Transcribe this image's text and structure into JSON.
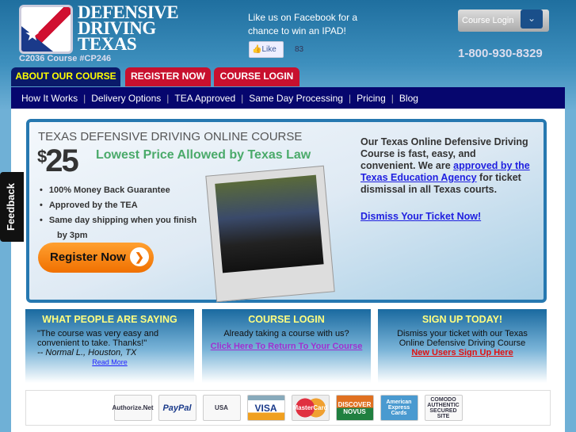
{
  "header": {
    "logo_lines": [
      "DEFENSIVE",
      "DRIVING",
      "TEXAS"
    ],
    "course_number": "C2036 Course #CP246",
    "facebook_text": "Like us on Facebook for a chance to win an IPAD!",
    "like_label": "Like",
    "like_count": "83",
    "course_login": "Course Login",
    "phone": "1-800-930-8329"
  },
  "tabs": [
    "ABOUT OUR COURSE",
    "REGISTER NOW",
    "COURSE LOGIN"
  ],
  "nav": [
    "How It Works",
    "Delivery Options",
    "TEA Approved",
    "Same Day Processing",
    "Pricing",
    "Blog"
  ],
  "hero": {
    "title": "TEXAS DEFENSIVE DRIVING ONLINE COURSE",
    "currency": "$",
    "price": "25",
    "tagline": "Lowest Price Allowed by Texas Law",
    "bullets": [
      "100% Money Back Guarantee",
      "Approved by the TEA",
      "Same day shipping when you finish"
    ],
    "bullet_cont": "by 3pm",
    "register": "Register Now",
    "desc_pre": "Our Texas Online Defensive Driving Course is fast, easy, and convenient. We are ",
    "desc_link": "approved by the Texas Education Agency",
    "desc_post": " for ticket dismissal in all Texas courts.",
    "dismiss": "Dismiss Your Ticket Now!"
  },
  "boxes": {
    "testimonial": {
      "title": "WHAT PEOPLE ARE SAYING",
      "quote": "\"The course was very easy and convenient to take. Thanks!\"",
      "author": "-- Normal L., Houston, TX",
      "link": "Read More"
    },
    "login": {
      "title": "COURSE LOGIN",
      "text": "Already taking a course with us?",
      "link": "Click Here To Return To Your Course"
    },
    "signup": {
      "title": "SIGN UP TODAY!",
      "text": "Dismiss your ticket with our Texas Online Defensive Driving Course",
      "link": "New Users Sign Up Here"
    }
  },
  "payments": [
    "Authorize.Net",
    "PayPal",
    "USA",
    "VISA",
    "MasterCard",
    "DISCOVER NOVUS",
    "American Express Cards",
    "COMODO AUTHENTIC SECURED SITE"
  ],
  "feedback": "Feedback"
}
